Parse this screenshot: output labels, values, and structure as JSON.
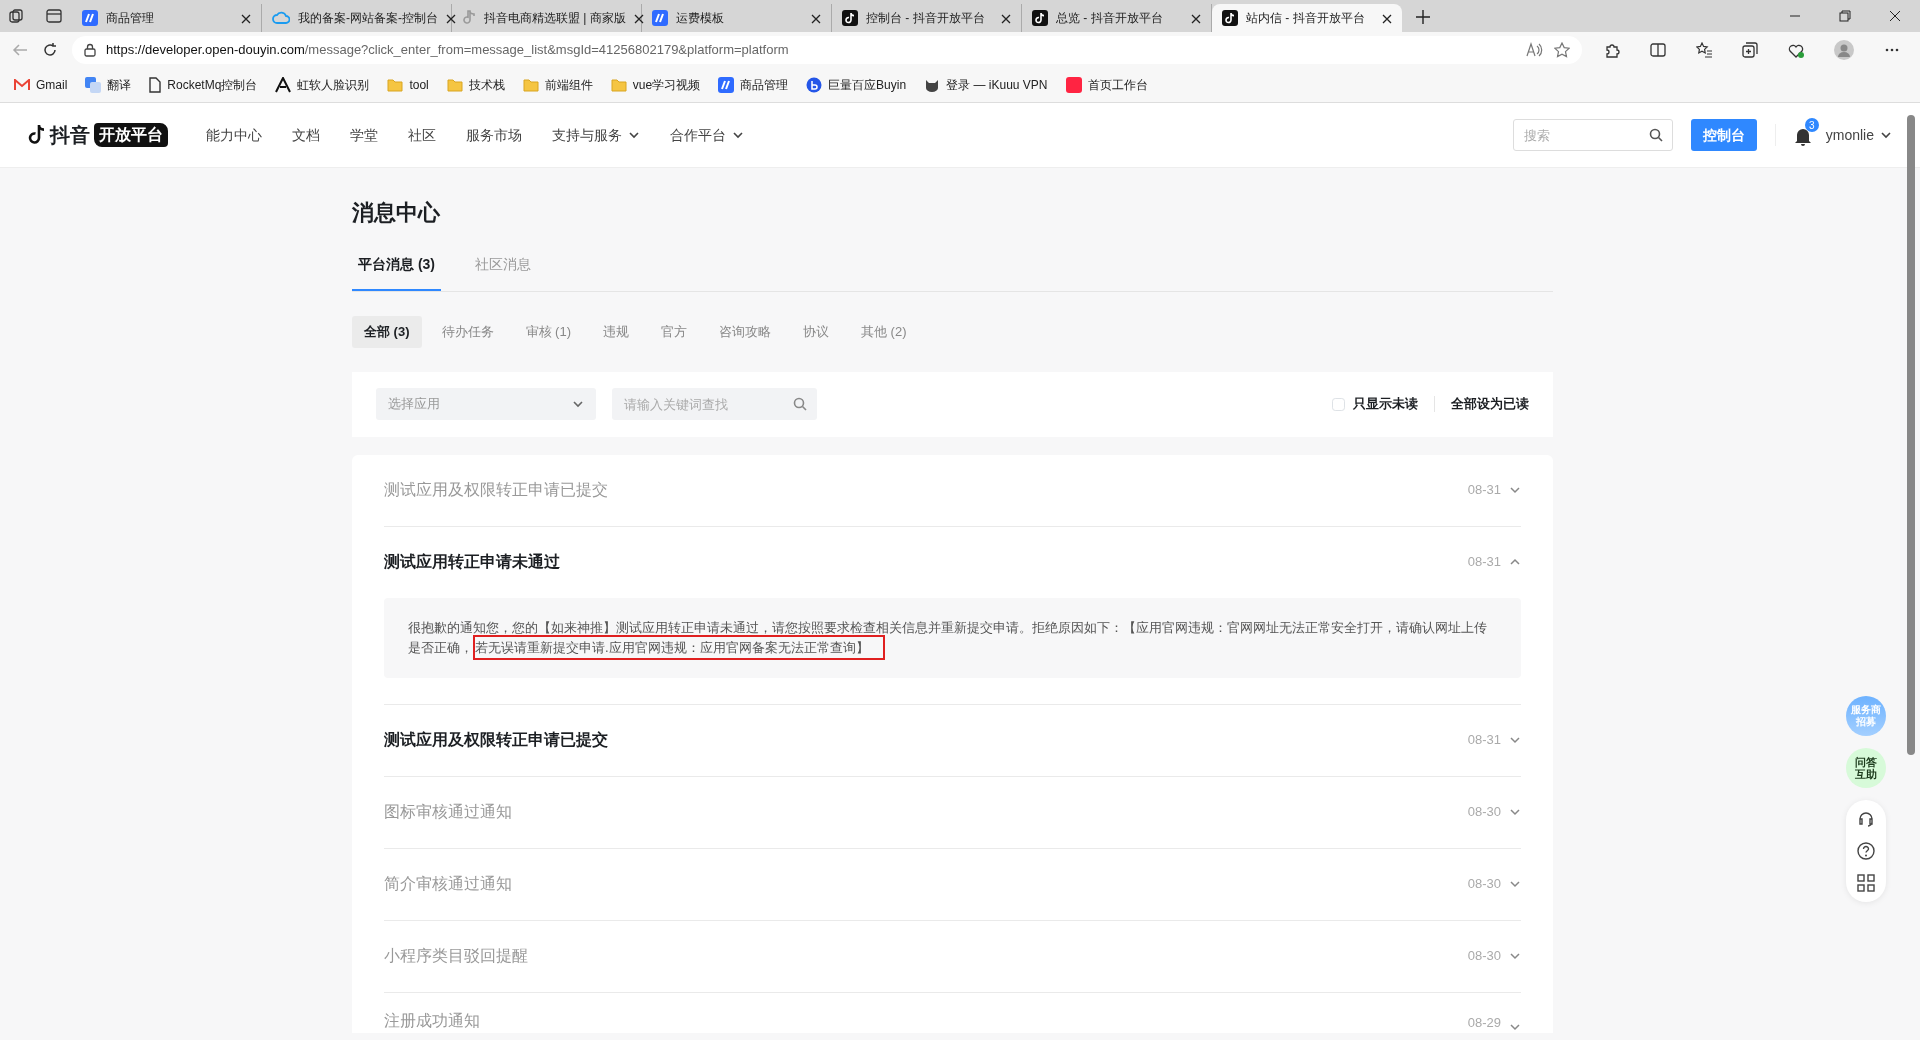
{
  "browser": {
    "tabs": [
      {
        "title": "商品管理",
        "kind": "brand",
        "selected": false
      },
      {
        "title": "我的备案-网站备案-控制台",
        "kind": "cloud",
        "selected": false
      },
      {
        "title": "抖音电商精选联盟 | 商家版",
        "kind": "note",
        "selected": false
      },
      {
        "title": "运费模板",
        "kind": "brand",
        "selected": false
      },
      {
        "title": "控制台 - 抖音开放平台",
        "kind": "douyin",
        "selected": false
      },
      {
        "title": "总览 - 抖音开放平台",
        "kind": "douyin",
        "selected": false
      },
      {
        "title": "站内信 - 抖音开放平台",
        "kind": "douyin",
        "selected": true
      }
    ],
    "url": {
      "host": "https://developer.open-douyin.com",
      "path": "/message?click_enter_from=message_list&msgId=41256802179&platform=platform"
    },
    "bookmarks": [
      {
        "label": "Gmail",
        "kind": "mail"
      },
      {
        "label": "翻译",
        "kind": "translate"
      },
      {
        "label": "RocketMq控制台",
        "kind": "page"
      },
      {
        "label": "虹软人脸识别",
        "kind": "arc"
      },
      {
        "label": "tool",
        "kind": "folder"
      },
      {
        "label": "技术栈",
        "kind": "folder"
      },
      {
        "label": "前端组件",
        "kind": "folder"
      },
      {
        "label": "vue学习视频",
        "kind": "folder"
      },
      {
        "label": "商品管理",
        "kind": "brand"
      },
      {
        "label": "巨量百应Buyin",
        "kind": "circle"
      },
      {
        "label": "登录 — iKuuu VPN",
        "kind": "cat"
      },
      {
        "label": "首页工作台",
        "kind": "red"
      }
    ]
  },
  "site": {
    "logo": {
      "word": "抖音",
      "tag": "开放平台"
    },
    "nav": [
      {
        "label": "能力中心",
        "dropdown": false
      },
      {
        "label": "文档",
        "dropdown": false
      },
      {
        "label": "学堂",
        "dropdown": false
      },
      {
        "label": "社区",
        "dropdown": false
      },
      {
        "label": "服务市场",
        "dropdown": false
      },
      {
        "label": "支持与服务",
        "dropdown": true
      },
      {
        "label": "合作平台",
        "dropdown": true
      }
    ],
    "search": {
      "placeholder": "搜索"
    },
    "console_button": "控制台",
    "notifications": "3",
    "user": "ymonlie"
  },
  "page": {
    "title": "消息中心",
    "tabs": [
      {
        "label": "平台消息 (3)",
        "selected": true
      },
      {
        "label": "社区消息",
        "selected": false
      }
    ],
    "filters": [
      {
        "label": "全部 (3)",
        "selected": true
      },
      {
        "label": "待办任务",
        "selected": false
      },
      {
        "label": "审核 (1)",
        "selected": false
      },
      {
        "label": "违规",
        "selected": false
      },
      {
        "label": "官方",
        "selected": false
      },
      {
        "label": "咨询攻略",
        "selected": false
      },
      {
        "label": "协议",
        "selected": false
      },
      {
        "label": "其他 (2)",
        "selected": false
      }
    ],
    "app_select": {
      "placeholder": "选择应用"
    },
    "keyword": {
      "placeholder": "请输入关键词查找"
    },
    "unread_only": {
      "label": "只显示未读",
      "checked": false
    },
    "mark_all_read": "全部设为已读"
  },
  "messages": [
    {
      "title": "测试应用及权限转正申请已提交",
      "date": "08-31",
      "unread": false,
      "expanded": false
    },
    {
      "title": "测试应用转正申请未通过",
      "date": "08-31",
      "unread": true,
      "expanded": true,
      "body": "很抱歉的通知您，您的【如来神推】测试应用转正申请未通过，请您按照要求检查相关信息并重新提交申请。拒绝原因如下：【应用官网违规：官网网址无法正常安全打开，请确认网址上传是否正确，",
      "highlight": "若无误请重新提交申请.应用官网违规：应用官网备案无法正常查询】"
    },
    {
      "title": "测试应用及权限转正申请已提交",
      "date": "08-31",
      "unread": true,
      "expanded": false
    },
    {
      "title": "图标审核通过通知",
      "date": "08-30",
      "unread": false,
      "expanded": false
    },
    {
      "title": "简介审核通过通知",
      "date": "08-30",
      "unread": false,
      "expanded": false
    },
    {
      "title": "小程序类目驳回提醒",
      "date": "08-30",
      "unread": false,
      "expanded": false
    },
    {
      "title": "注册成功通知",
      "date": "08-29",
      "unread": false,
      "expanded": false
    }
  ],
  "floating": [
    {
      "lines": [
        "服务商",
        "招募"
      ],
      "kind": "blue"
    },
    {
      "lines": [
        "问答",
        "互助"
      ],
      "kind": "green"
    }
  ]
}
